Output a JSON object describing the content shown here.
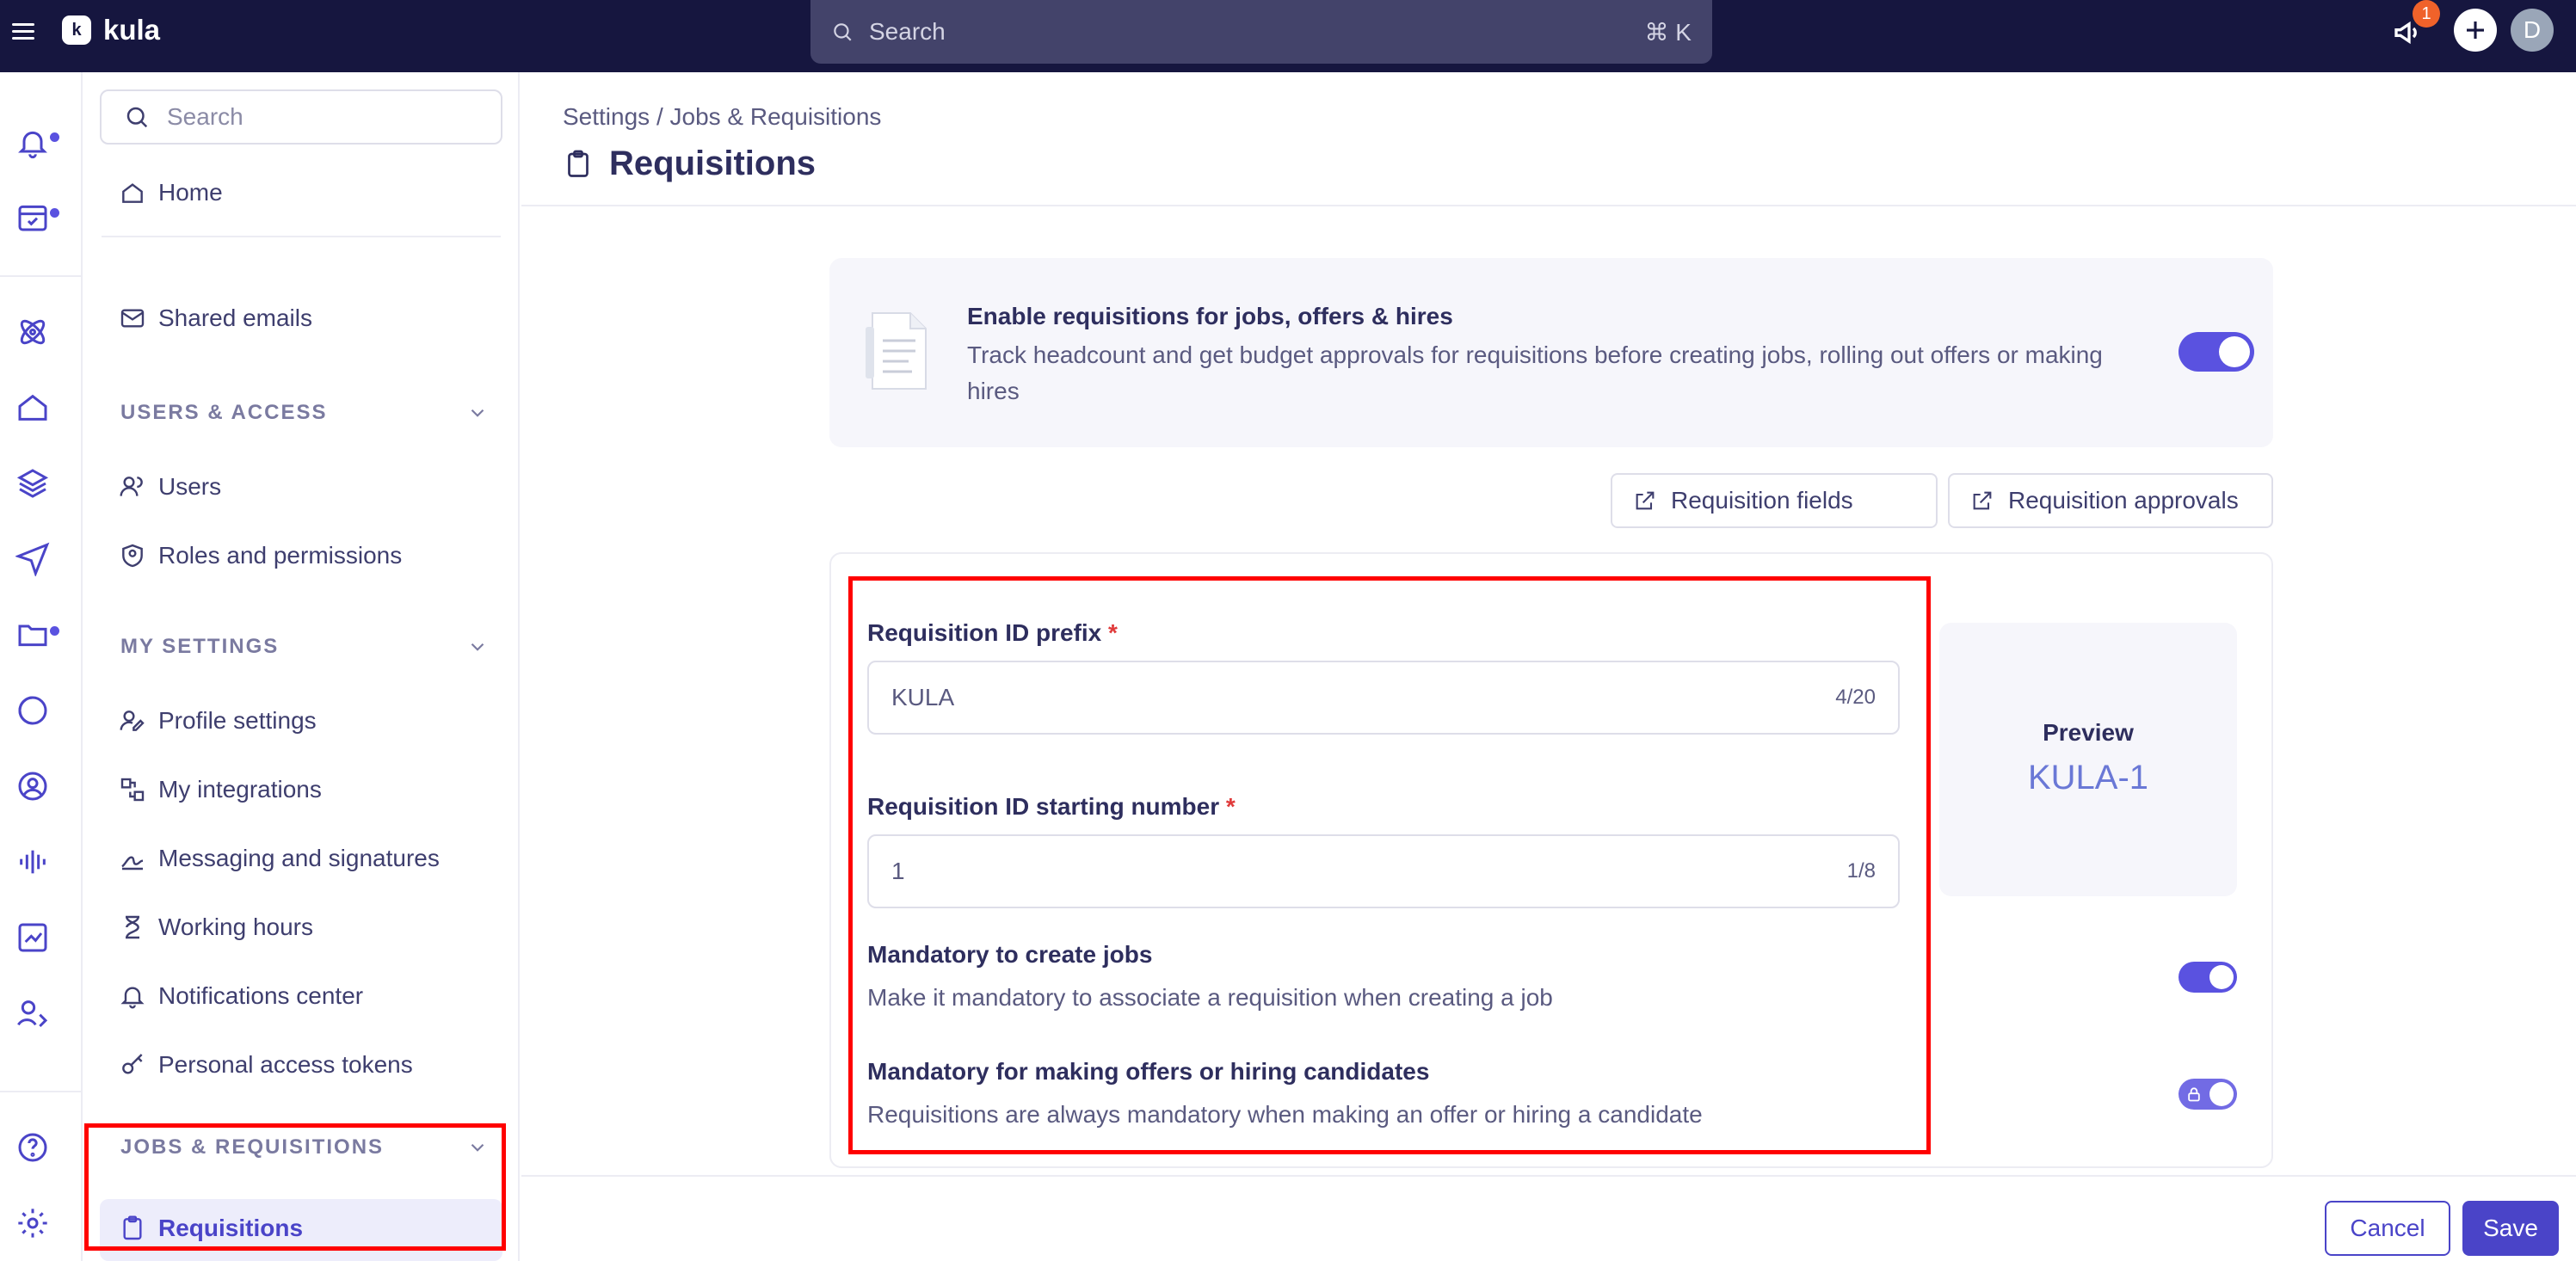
{
  "app": {
    "name": "kula"
  },
  "topbar": {
    "search_placeholder": "Search",
    "search_shortcut": "⌘ K",
    "notification_count": "1",
    "avatar_initial": "D"
  },
  "sidebar": {
    "search_placeholder": "Search",
    "home": "Home",
    "shared_emails": "Shared emails",
    "sections": {
      "users_access": "USERS & ACCESS",
      "my_settings": "MY SETTINGS",
      "jobs_requisitions": "JOBS & REQUISITIONS"
    },
    "users_access_items": [
      "Users",
      "Roles and permissions"
    ],
    "my_settings_items": [
      "Profile settings",
      "My integrations",
      "Messaging and signatures",
      "Working hours",
      "Notifications center",
      "Personal access tokens"
    ],
    "jobs_items": [
      "Requisitions"
    ]
  },
  "main": {
    "breadcrumb": "Settings / Jobs & Requisitions",
    "title": "Requisitions",
    "enable": {
      "title": "Enable requisitions for jobs, offers & hires",
      "description": "Track headcount and get budget approvals for requisitions before creating jobs, rolling out offers or making hires",
      "enabled": true
    },
    "links": {
      "fields": "Requisition fields",
      "approvals": "Requisition approvals"
    },
    "form": {
      "prefix_label": "Requisition ID prefix",
      "prefix_value": "KULA",
      "prefix_count": "4/20",
      "start_label": "Requisition ID starting number",
      "start_value": "1",
      "start_count": "1/8",
      "required_mark": "*",
      "jobs_title": "Mandatory to create jobs",
      "jobs_desc": "Make it mandatory to associate a requisition when creating a job",
      "offers_title": "Mandatory for making offers or hiring candidates",
      "offers_desc": "Requisitions are always mandatory when making an offer or hiring a candidate"
    },
    "preview": {
      "label": "Preview",
      "value": "KULA-1"
    }
  },
  "footer": {
    "cancel": "Cancel",
    "save": "Save"
  },
  "colors": {
    "topbar": "#16163f",
    "accent": "#5a52e0",
    "primary_button": "#4a44c8",
    "highlight": "#ff0000"
  }
}
